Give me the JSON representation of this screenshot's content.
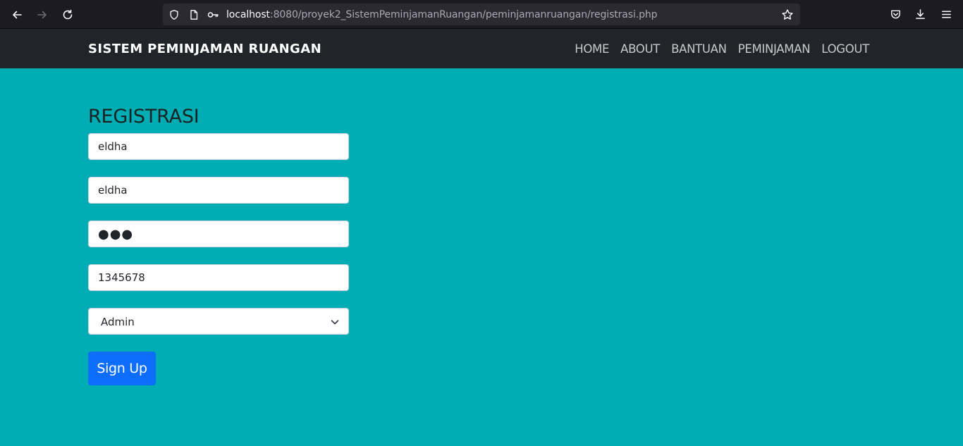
{
  "browser": {
    "url_host": "localhost",
    "url_rest": ":8080/proyek2_SistemPeminjamanRuangan/peminjamanruangan/registrasi.php",
    "icons": [
      "back-icon",
      "forward-icon",
      "reload-icon",
      "shield-icon",
      "page-icon",
      "key-icon",
      "star-icon",
      "pocket-icon",
      "download-icon",
      "menu-icon"
    ]
  },
  "navbar": {
    "brand": "SISTEM PEMINJAMAN RUANGAN",
    "items": [
      "HOME",
      "ABOUT",
      "BANTUAN",
      "PEMINJAMAN",
      "LOGOUT"
    ]
  },
  "form": {
    "title": "REGISTRASI",
    "name_value": "eldha",
    "username_value": "eldha",
    "password_value": "●●●",
    "phone_value": "1345678",
    "role_selected": "Admin",
    "submit_label": "Sign Up"
  },
  "colors": {
    "page_bg": "#00adb5",
    "navbar_bg": "#212529",
    "button_bg": "#0d6efd"
  }
}
